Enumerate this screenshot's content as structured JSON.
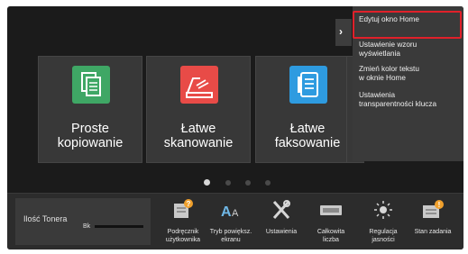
{
  "tiles": [
    {
      "label": "Proste\nkopiowanie",
      "icon": "copy-icon",
      "color": "#3fa765"
    },
    {
      "label": "Łatwe\nskanowanie",
      "icon": "scanner-icon",
      "color": "#e84b47"
    },
    {
      "label": "Łatwe\nfaksowanie",
      "icon": "fax-icon",
      "color": "#2e9be0"
    }
  ],
  "pager": {
    "pages": 4,
    "current": 1
  },
  "toner": {
    "label": "Ilość Tonera",
    "color_label": "Bk"
  },
  "quick_buttons": [
    {
      "label": "Podręcznik\nużytkownika",
      "icon": "user-manual-icon"
    },
    {
      "label": "Tryb powiększ.\nekranu",
      "icon": "text-magnify-icon"
    },
    {
      "label": "Ustawienia",
      "icon": "settings-tools-icon"
    },
    {
      "label": "Całkowita\nliczba",
      "icon": "counter-icon"
    },
    {
      "label": "Regulacja\njasności",
      "icon": "brightness-icon"
    },
    {
      "label": "Stan zadania",
      "icon": "job-status-icon"
    }
  ],
  "action_panel": {
    "tab_icon": "chevron-right-icon",
    "items": [
      {
        "label": "Edytuj okno Home"
      },
      {
        "label": "Ustawienie wzoru\nwyświetlania"
      },
      {
        "label": "Zmień kolor tekstu\nw oknie Home"
      },
      {
        "label": "Ustawienia\ntransparentności klucza"
      }
    ],
    "highlight_color": "#e0202a"
  }
}
